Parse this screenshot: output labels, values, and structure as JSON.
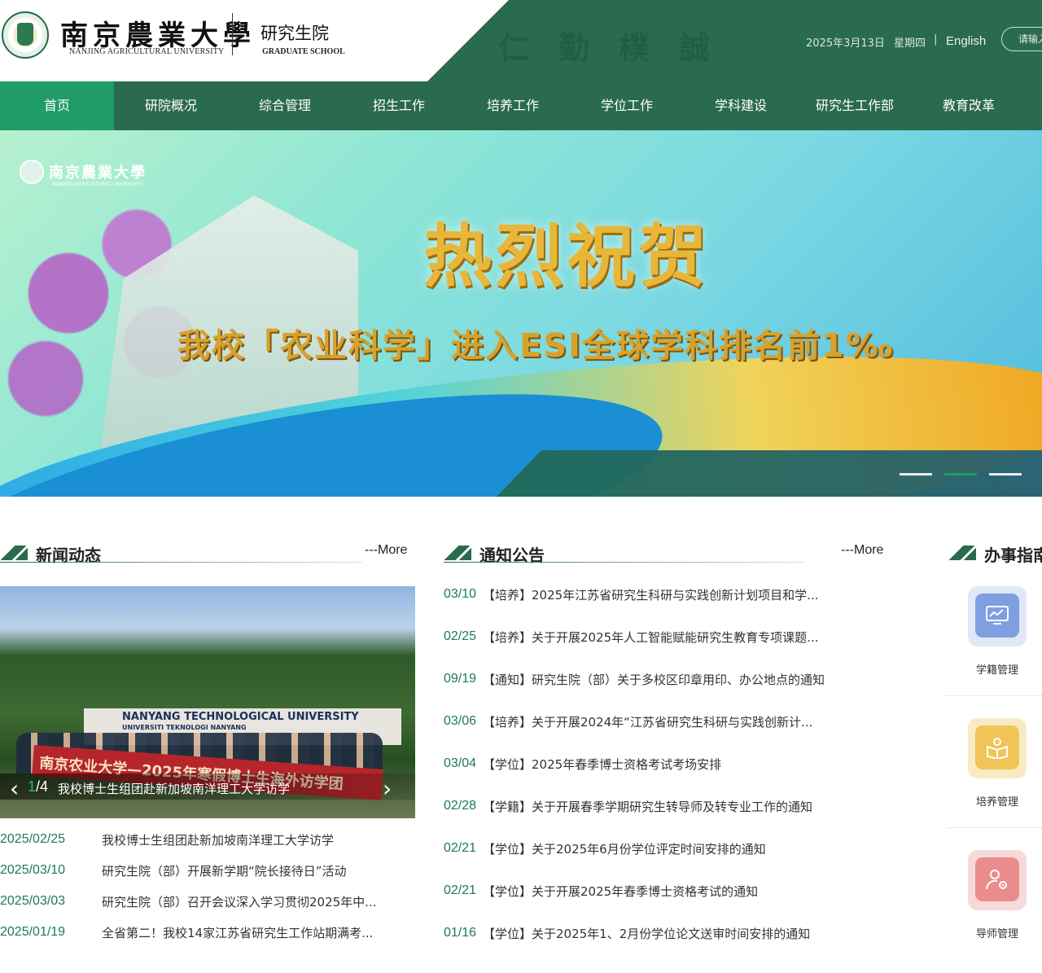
{
  "header": {
    "logo_cn": "南京農業大學",
    "logo_en": "NANJING AGRICULTURAL UNIVERSITY",
    "dept_cn": "研究生院",
    "dept_en": "GRADUATE SCHOOL",
    "motto": "仁勤樸誠",
    "date": "2025年3月13日",
    "weekday": "星期四",
    "separator": "|",
    "english_link": "English",
    "search_placeholder": "请输入"
  },
  "nav": {
    "items": [
      "首页",
      "研院概况",
      "综合管理",
      "招生工作",
      "培养工作",
      "学位工作",
      "学科建设",
      "研究生工作部",
      "教育改革"
    ],
    "active_index": 0
  },
  "banner": {
    "logo_cn": "南京農業大學",
    "logo_en": "NANJING AGRICULTURAL UNIVERSITY",
    "title": "热烈祝贺",
    "subtitle": "我校「农业科学」进入ESI全球学科排名前1‰",
    "slide_count": 3,
    "active_slide": 1
  },
  "news": {
    "heading": "新闻动态",
    "more": "---More",
    "photo": {
      "sign_text": "NANYANG TECHNOLOGICAL UNIVERSITY",
      "sign_sub": "UNIVERSITI TEKNOLOGI NANYANG",
      "banner_text": "南京农业大学—2025年寒假博士生海外访学团",
      "current": "1",
      "total": "/4",
      "caption": "我校博士生组团赴新加坡南洋理工大学访学"
    },
    "items": [
      {
        "date": "2025/02/25",
        "title": "我校博士生组团赴新加坡南洋理工大学访学"
      },
      {
        "date": "2025/03/10",
        "title": "研究生院（部）开展新学期“院长接待日”活动"
      },
      {
        "date": "2025/03/03",
        "title": "研究生院（部）召开会议深入学习贯彻2025年中..."
      },
      {
        "date": "2025/01/19",
        "title": "全省第二！我校14家江苏省研究生工作站期满考..."
      }
    ]
  },
  "notices": {
    "heading": "通知公告",
    "more": "---More",
    "items": [
      {
        "date": "03/10",
        "title": "【培养】2025年江苏省研究生科研与实践创新计划项目和学..."
      },
      {
        "date": "02/25",
        "title": "【培养】关于开展2025年人工智能赋能研究生教育专项课题..."
      },
      {
        "date": "09/19",
        "title": "【通知】研究生院（部）关于多校区印章用印、办公地点的通知"
      },
      {
        "date": "03/06",
        "title": "【培养】关于开展2024年“江苏省研究生科研与实践创新计..."
      },
      {
        "date": "03/04",
        "title": "【学位】2025年春季博士资格考试考场安排"
      },
      {
        "date": "02/28",
        "title": "【学籍】关于开展春季学期研究生转导师及转专业工作的通知"
      },
      {
        "date": "02/21",
        "title": "【学位】关于2025年6月份学位评定时间安排的通知"
      },
      {
        "date": "02/21",
        "title": "【学位】关于开展2025年春季博士资格考试的通知"
      },
      {
        "date": "01/16",
        "title": "【学位】关于2025年1、2月份学位论文送审时间安排的通知"
      }
    ]
  },
  "guide": {
    "heading": "办事指南",
    "items": [
      {
        "label": "学籍管理",
        "icon": "monitor-chart-icon",
        "outer": "#dfe8f6",
        "inner": "#7f9fe0",
        "glyph": "📈"
      },
      {
        "label": "培养管理",
        "icon": "book-person-icon",
        "outer": "#f8ebc4",
        "inner": "#f0c456",
        "glyph": "📖"
      },
      {
        "label": "导师管理",
        "icon": "person-gear-icon",
        "outer": "#f6dada",
        "inner": "#ea8c8c",
        "glyph": "⚙"
      }
    ]
  },
  "colors": {
    "primary": "#2a6a4e",
    "accent": "#1f9c68",
    "date_text": "#1d7a54"
  }
}
